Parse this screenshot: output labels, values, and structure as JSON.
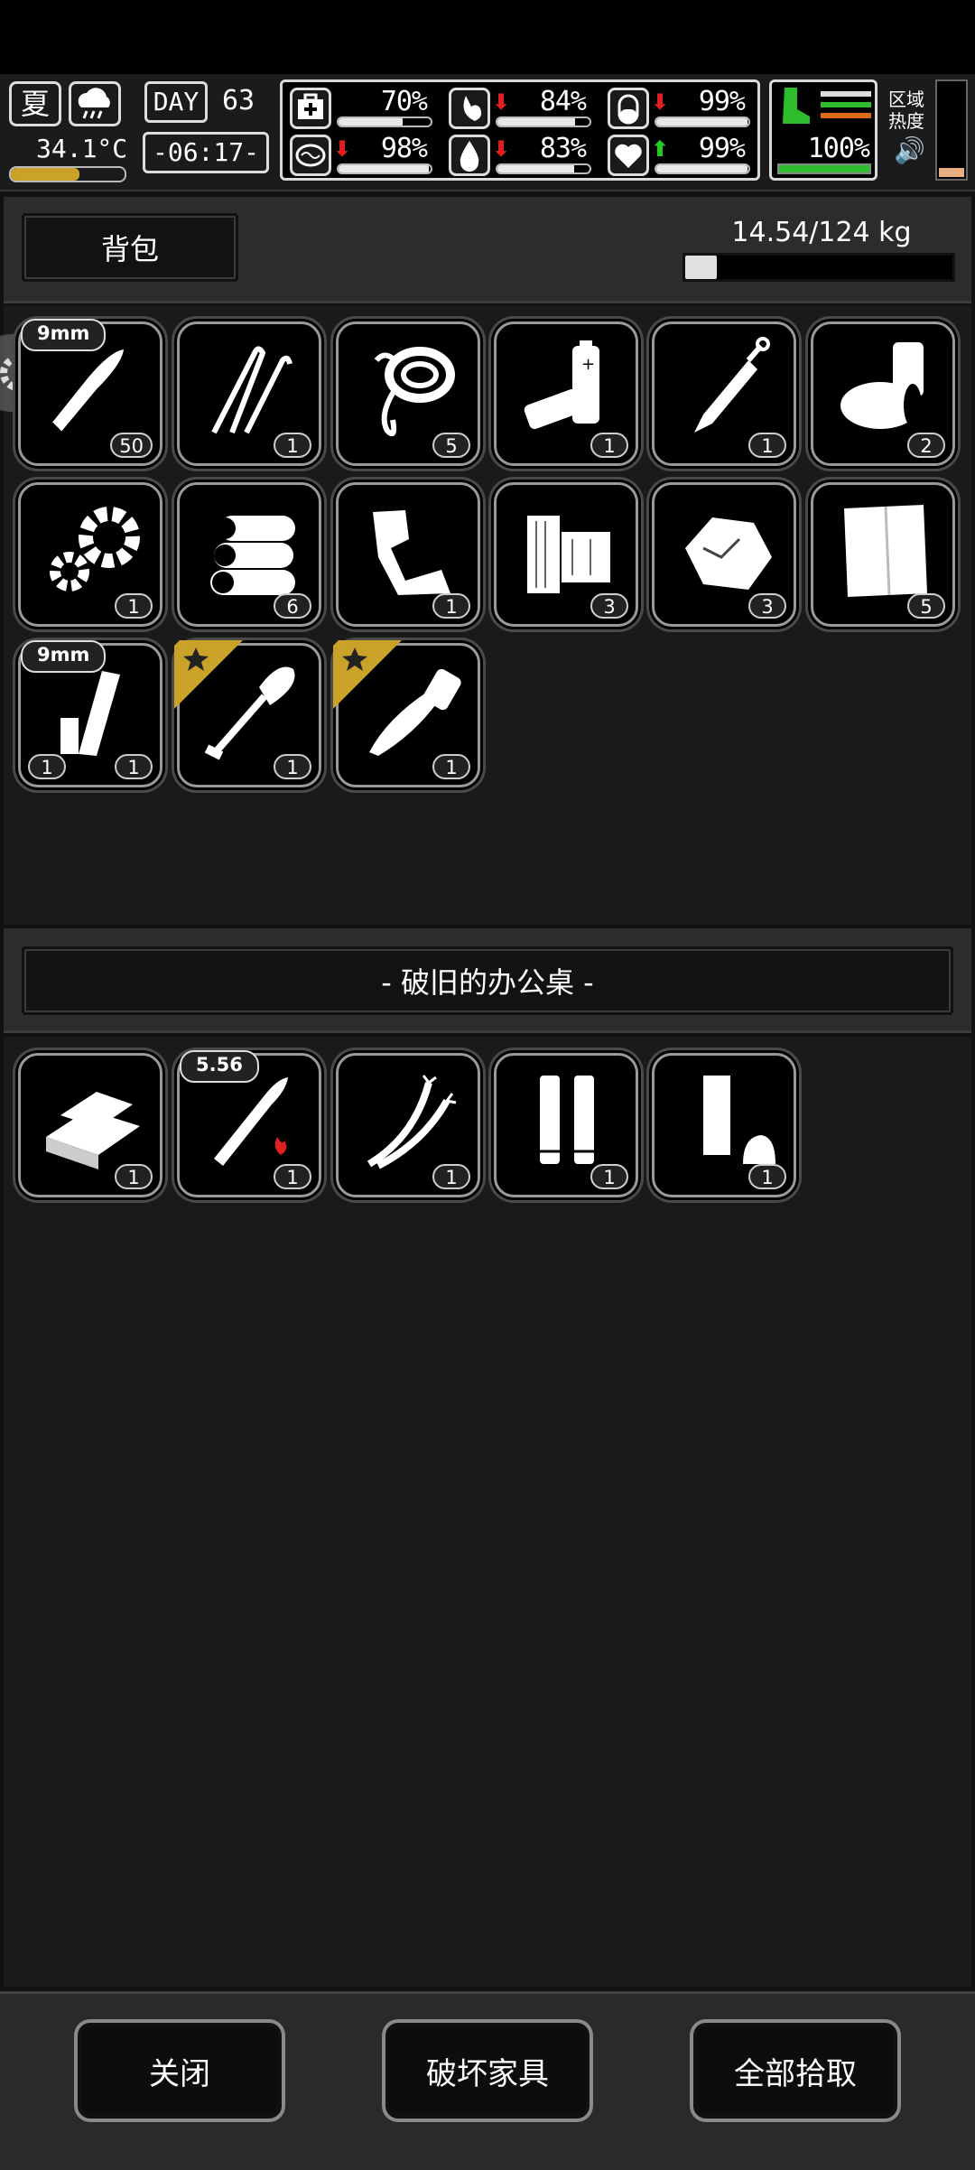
{
  "hud": {
    "season": "夏",
    "day_label": "DAY",
    "day": "63",
    "temperature": "34.1°C",
    "time": "-06:17-",
    "stats": [
      {
        "icon": "medkit-icon",
        "value": "70%",
        "level": 0.7,
        "trend": ""
      },
      {
        "icon": "stomach-icon",
        "value": "84%",
        "level": 0.84,
        "trend": "down"
      },
      {
        "icon": "pill-icon",
        "value": "99%",
        "level": 0.99,
        "trend": "down"
      },
      {
        "icon": "brain-icon",
        "value": "98%",
        "level": 0.98,
        "trend": "down"
      },
      {
        "icon": "water-drop-icon",
        "value": "83%",
        "level": 0.83,
        "trend": "down"
      },
      {
        "icon": "heart-icon",
        "value": "99%",
        "level": 0.99,
        "trend": "up"
      }
    ],
    "stamina": "100%",
    "zone_label_1": "区域",
    "zone_label_2": "热度",
    "colors": {
      "down_arrow": "#e02020",
      "up_arrow": "#22cc22",
      "stamina": "#2dbd2d",
      "warn": "#e06a1a",
      "gold": "#c9a227"
    }
  },
  "backpack": {
    "title": "背包",
    "weight": "14.54/124 kg",
    "weight_fraction": 0.117,
    "items": [
      {
        "name": "9mm-bullet",
        "icon": "bullet-icon",
        "count": "50",
        "caliber": "9mm"
      },
      {
        "name": "lockpick",
        "icon": "lockpick-icon",
        "count": "1"
      },
      {
        "name": "rope",
        "icon": "rope-icon",
        "count": "5"
      },
      {
        "name": "batteries",
        "icon": "battery-icon",
        "count": "1"
      },
      {
        "name": "syringe",
        "icon": "syringe-icon",
        "count": "1"
      },
      {
        "name": "tape",
        "icon": "tape-icon",
        "count": "2"
      },
      {
        "name": "gears",
        "icon": "gears-icon",
        "count": "1"
      },
      {
        "name": "logs",
        "icon": "logs-icon",
        "count": "6"
      },
      {
        "name": "scrap",
        "icon": "scrap-icon",
        "count": "1"
      },
      {
        "name": "planks",
        "icon": "planks-icon",
        "count": "3"
      },
      {
        "name": "ore",
        "icon": "ore-icon",
        "count": "3"
      },
      {
        "name": "cloth",
        "icon": "cloth-icon",
        "count": "5"
      },
      {
        "name": "magazine",
        "icon": "magazine-icon",
        "count": "1",
        "count_left": "1",
        "caliber": "9mm"
      },
      {
        "name": "shovel",
        "icon": "shovel-icon",
        "count": "1",
        "starred": true
      },
      {
        "name": "knife",
        "icon": "knife-icon",
        "count": "1",
        "starred": true
      }
    ]
  },
  "container": {
    "title": "- 破旧的办公桌 -",
    "items": [
      {
        "name": "metal-bar",
        "icon": "metal-bar-icon",
        "count": "1"
      },
      {
        "name": "rifle-round",
        "icon": "rifle-round-icon",
        "count": "1",
        "caliber": "5.56"
      },
      {
        "name": "wires",
        "icon": "wires-icon",
        "count": "1"
      },
      {
        "name": "shell-casings",
        "icon": "shell-casings-icon",
        "count": "1"
      },
      {
        "name": "scrap-paper",
        "icon": "paper-icon",
        "count": "1"
      }
    ]
  },
  "footer": {
    "close": "关闭",
    "destroy": "破坏家具",
    "take_all": "全部拾取"
  }
}
